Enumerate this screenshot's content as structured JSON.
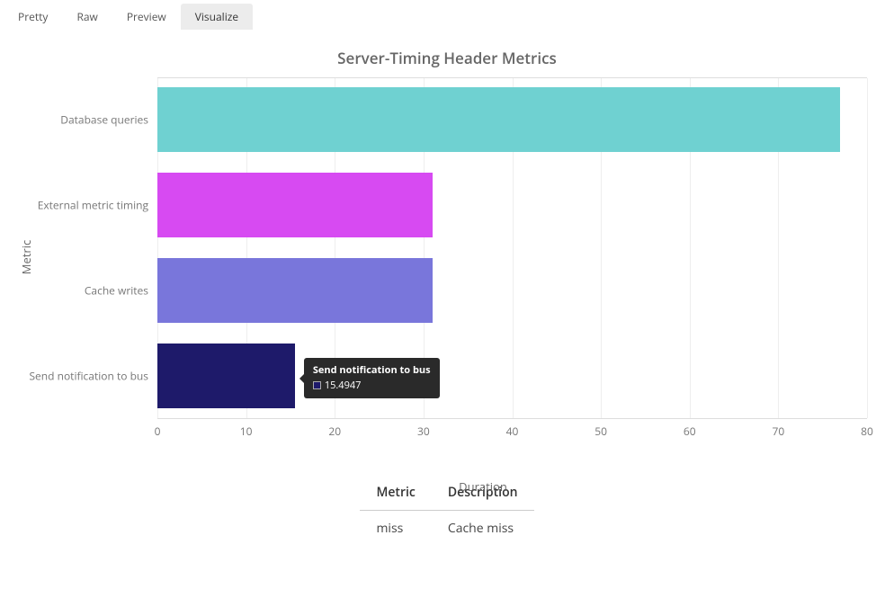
{
  "tabs": {
    "items": [
      {
        "label": "Pretty",
        "active": false
      },
      {
        "label": "Raw",
        "active": false
      },
      {
        "label": "Preview",
        "active": false
      },
      {
        "label": "Visualize",
        "active": true
      }
    ]
  },
  "chart_data": {
    "type": "bar",
    "orientation": "horizontal",
    "title": "Server-Timing Header Metrics",
    "xlabel": "Duration",
    "ylabel": "Metric",
    "xlim": [
      0,
      80
    ],
    "xticks": [
      0,
      10,
      20,
      30,
      40,
      50,
      60,
      70,
      80
    ],
    "categories": [
      "Database queries",
      "External metric timing",
      "Cache writes",
      "Send notification to bus"
    ],
    "values": [
      77,
      31,
      31,
      15.4947
    ],
    "colors": [
      "#6fd1d1",
      "#d74af2",
      "#7976db",
      "#1e1a6a"
    ]
  },
  "tooltip": {
    "category": "Send notification to bus",
    "value": "15.4947",
    "swatch_color": "#1e1a6a"
  },
  "table": {
    "headers": [
      "Metric",
      "Description"
    ],
    "rows": [
      {
        "metric": "miss",
        "description": "Cache miss"
      }
    ]
  }
}
